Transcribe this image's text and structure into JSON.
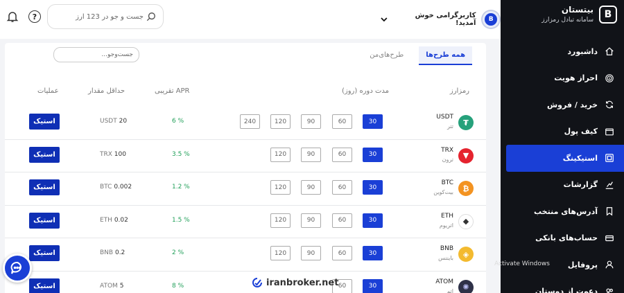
{
  "brand": {
    "name": "بیتستان",
    "subtitle": "سامانه تبادل رمزارز",
    "logo": "B"
  },
  "header": {
    "welcome": "کاربرگرامی خوش آمدید!",
    "search_placeholder": "جست و جو در 123 ارز",
    "help_label": "?",
    "avatar_label": "B"
  },
  "sidebar": {
    "items": [
      {
        "label": "داشبورد",
        "icon": "home-icon"
      },
      {
        "label": "احراز هویت",
        "icon": "fingerprint-icon"
      },
      {
        "label": "خرید / فروش",
        "icon": "exchange-icon"
      },
      {
        "label": "کیف پول",
        "icon": "wallet-icon"
      },
      {
        "label": "استیکینگ",
        "icon": "staking-icon",
        "active": true
      },
      {
        "label": "گزارشات",
        "icon": "report-icon"
      },
      {
        "label": "آدرس‌های منتخب",
        "icon": "bookmark-icon"
      },
      {
        "label": "حساب‌های بانکی",
        "icon": "bank-card-icon"
      },
      {
        "label": "پروفایل",
        "icon": "user-icon"
      },
      {
        "label": "دعوت از دوستان",
        "icon": "invite-icon"
      }
    ]
  },
  "tabs": {
    "all": "همه طرح‌ها",
    "mine": "طرح‌های‌من"
  },
  "plan_search_placeholder": "جست‌وجو...",
  "columns": {
    "coin": "رمزارز",
    "duration": "مدت دوره (روز)",
    "apr": "APR تقریبی",
    "min": "حداقل مقدار",
    "actions": "عملیات"
  },
  "stake_label": "استیک",
  "rows": [
    {
      "symbol": "USDT",
      "name": "تتر",
      "color": "#26a17b",
      "glyph": "₮",
      "durations": [
        "30",
        "60",
        "90",
        "120",
        "240"
      ],
      "apr": "6 %",
      "min_value": "20",
      "min_unit": "USDT"
    },
    {
      "symbol": "TRX",
      "name": "ترون",
      "color": "#e5232e",
      "glyph": "▼",
      "durations": [
        "30",
        "60",
        "90",
        "120"
      ],
      "apr": "3.5 %",
      "min_value": "100",
      "min_unit": "TRX"
    },
    {
      "symbol": "BTC",
      "name": "بیت‌کوین",
      "color": "#f39321",
      "glyph": "₿",
      "durations": [
        "30",
        "60",
        "90",
        "120"
      ],
      "apr": "1.2 %",
      "min_value": "0.002",
      "min_unit": "BTC"
    },
    {
      "symbol": "ETH",
      "name": "اتریوم",
      "color": "#ffffff",
      "glyph": "◆",
      "durations": [
        "30",
        "60",
        "90",
        "120"
      ],
      "apr": "1.5 %",
      "min_value": "0.02",
      "min_unit": "ETH"
    },
    {
      "symbol": "BNB",
      "name": "بایننس",
      "color": "#f3ba2f",
      "glyph": "◈",
      "durations": [
        "30",
        "60",
        "90",
        "120"
      ],
      "apr": "2 %",
      "min_value": "0.2",
      "min_unit": "BNB"
    },
    {
      "symbol": "ATOM",
      "name": "اتم",
      "color": "#2e3148",
      "glyph": "✺",
      "durations": [
        "30",
        "60"
      ],
      "apr": "8 %",
      "min_value": "5",
      "min_unit": "ATOM"
    }
  ],
  "watermark": "iranbroker.net",
  "activate_text": "Activate Windows"
}
